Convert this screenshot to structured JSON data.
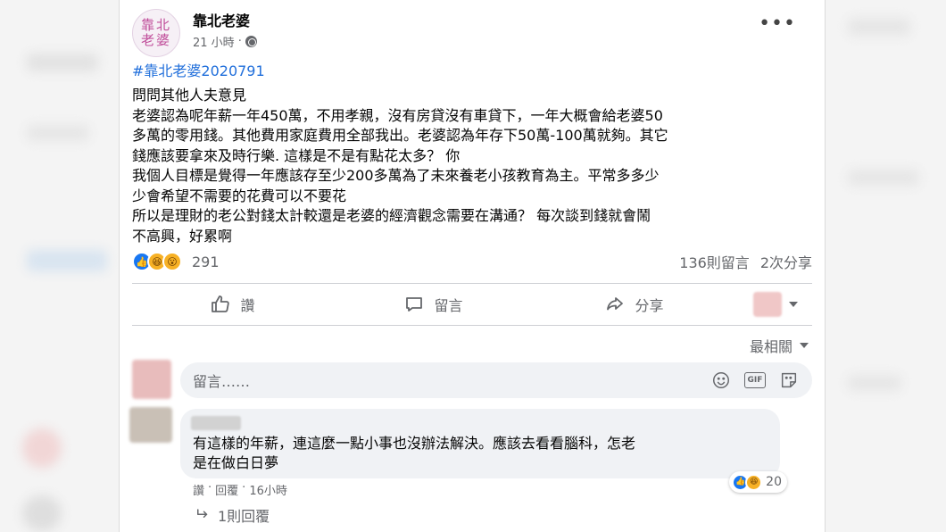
{
  "post": {
    "author": "靠北老婆",
    "avatar_text": "靠北老婆",
    "time": "21 小時",
    "meta_separator": "·",
    "more_icon": "more-icon",
    "hashtag": "#靠北老婆2020791",
    "body_lines": [
      "問問其他人夫意見",
      "老婆認為呢年薪一年450萬，不用孝親，沒有房貸沒有車貸下，一年大概會給老婆50",
      "多萬的零用錢。其他費用家庭費用全部我出。老婆認為年存下50萬-100萬就夠。其它",
      "錢應該要拿來及時行樂. 這樣是不是有點花太多？ 你",
      "我個人目標是覺得一年應該存至少200多萬為了未來養老小孩教育為主。平常多多少",
      "少會希望不需要的花費可以不要花",
      "所以是理財的老公對錢太計較還是老婆的經濟觀念需要在溝通？ 每次談到錢就會鬧",
      "不高興，好累啊"
    ]
  },
  "reactions": {
    "count": "291",
    "icons": [
      "like-icon",
      "haha-icon",
      "wow-icon"
    ],
    "like_glyph": "👍",
    "haha_glyph": "😆",
    "wow_glyph": "😮"
  },
  "stats": {
    "comments": "136則留言",
    "shares": "2次分享"
  },
  "actions": {
    "like": "讚",
    "comment": "留言",
    "share": "分享"
  },
  "sort": {
    "label": "最相關"
  },
  "composer": {
    "placeholder": "留言……",
    "icons": [
      "emoji-icon",
      "gif-icon",
      "sticker-icon"
    ],
    "gif_label": "GIF"
  },
  "comment": {
    "lines": [
      "有這樣的年薪，連這麼一點小事也沒辦法解決。應該去看看腦科，怎老",
      "是在做白日夢"
    ],
    "reaction_count": "20",
    "like": "讚",
    "reply": "回覆",
    "time": "16小時",
    "sep1": "·",
    "sep2": "·",
    "replies": "1則回覆"
  },
  "colors": {
    "link": "#216fdb",
    "like_blue": "#1877f2",
    "reaction_yellow": "#f7b125",
    "secondary_text": "#65676b"
  }
}
